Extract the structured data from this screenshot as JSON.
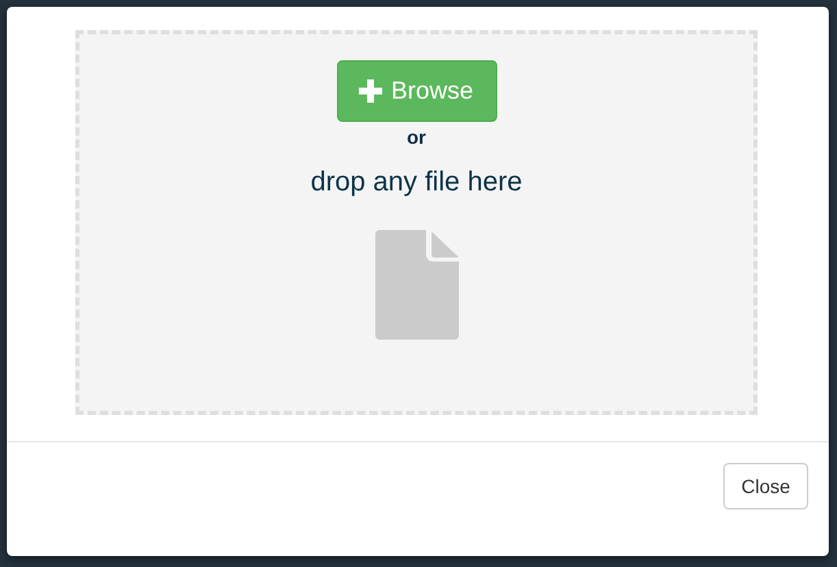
{
  "dropzone": {
    "browse_button": "Browse",
    "separator": "or",
    "message": "drop any file here"
  },
  "footer": {
    "buttons": [
      "Close"
    ]
  }
}
